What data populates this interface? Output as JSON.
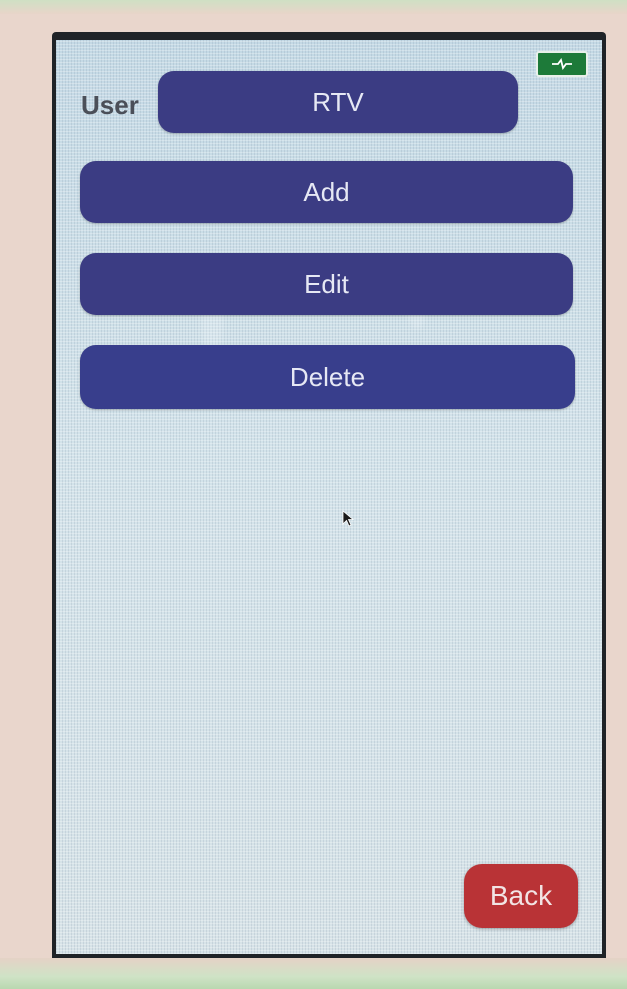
{
  "header": {
    "user_label": "User",
    "user_value": "RTV"
  },
  "actions": {
    "add_label": "Add",
    "edit_label": "Edit",
    "delete_label": "Delete"
  },
  "footer": {
    "back_label": "Back"
  },
  "status": {
    "battery_icon": "battery-charging-icon"
  },
  "colors": {
    "button": "#3b3c83",
    "back_button": "#b93336",
    "battery": "#1d7a39",
    "screen": "#c9dde7"
  }
}
